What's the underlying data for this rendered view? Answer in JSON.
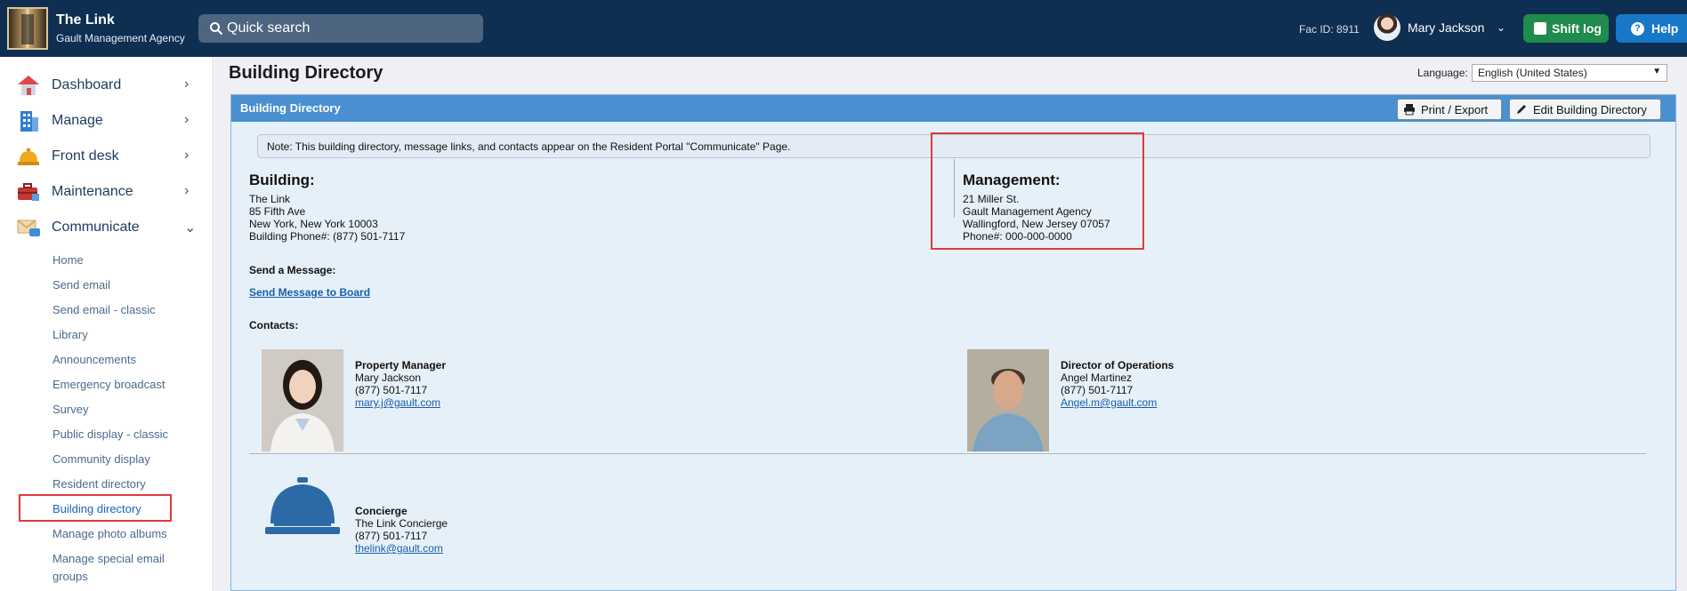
{
  "header": {
    "app_title": "The Link",
    "app_subtitle": "Gault Management Agency",
    "search_placeholder": "Quick search",
    "fac_id": "Fac ID: 8911",
    "user_name": "Mary Jackson",
    "shift_log_label": "Shift log",
    "help_label": "Help"
  },
  "sidebar": {
    "main_items": [
      {
        "label": "Dashboard",
        "icon": "house-icon"
      },
      {
        "label": "Manage",
        "icon": "building-icon"
      },
      {
        "label": "Front desk",
        "icon": "bell-icon"
      },
      {
        "label": "Maintenance",
        "icon": "toolbox-icon"
      },
      {
        "label": "Communicate",
        "icon": "envelope-chat-icon"
      }
    ],
    "sub_items": [
      "Home",
      "Send email",
      "Send email - classic",
      "Library",
      "Announcements",
      "Emergency broadcast",
      "Survey",
      "Public display - classic",
      "Community display",
      "Resident directory",
      "Building directory",
      "Manage photo albums",
      "Manage special email",
      "groups"
    ]
  },
  "page": {
    "title": "Building Directory",
    "language_label": "Language:",
    "language_value": "English (United States)"
  },
  "panel": {
    "title": "Building Directory",
    "print_label": "Print / Export",
    "edit_label": "Edit Building Directory",
    "note": "Note: This building directory, message links, and contacts appear on the Resident Portal \"Communicate\" Page."
  },
  "building": {
    "heading": "Building:",
    "name": "The Link",
    "street": "85 Fifth Ave",
    "city": "New York, New York 10003",
    "phone": "Building Phone#: (877) 501-7117"
  },
  "management": {
    "heading": "Management:",
    "street": "21 Miller St.",
    "name": "Gault Management Agency",
    "city": "Wallingford, New Jersey 07057",
    "phone": "Phone#: 000-000-0000"
  },
  "message": {
    "heading": "Send a Message:",
    "link": "Send Message to Board"
  },
  "contacts": {
    "heading": "Contacts:",
    "items": [
      {
        "role": "Property Manager",
        "name": "Mary Jackson",
        "phone": "(877) 501-7117",
        "email": "mary.j@gault.com"
      },
      {
        "role": "Director of Operations",
        "name": "Angel Martinez",
        "phone": "(877) 501-7117",
        "email": "Angel.m@gault.com"
      },
      {
        "role": "Concierge",
        "name": "The Link Concierge",
        "phone": "(877) 501-7117",
        "email": "thelink@gault.com"
      }
    ]
  },
  "colors": {
    "topbar": "#0e2f52",
    "panel_header": "#4a8fd0",
    "shift_log": "#1f8b4c",
    "help": "#1778c8",
    "highlight": "#e03a3a"
  }
}
